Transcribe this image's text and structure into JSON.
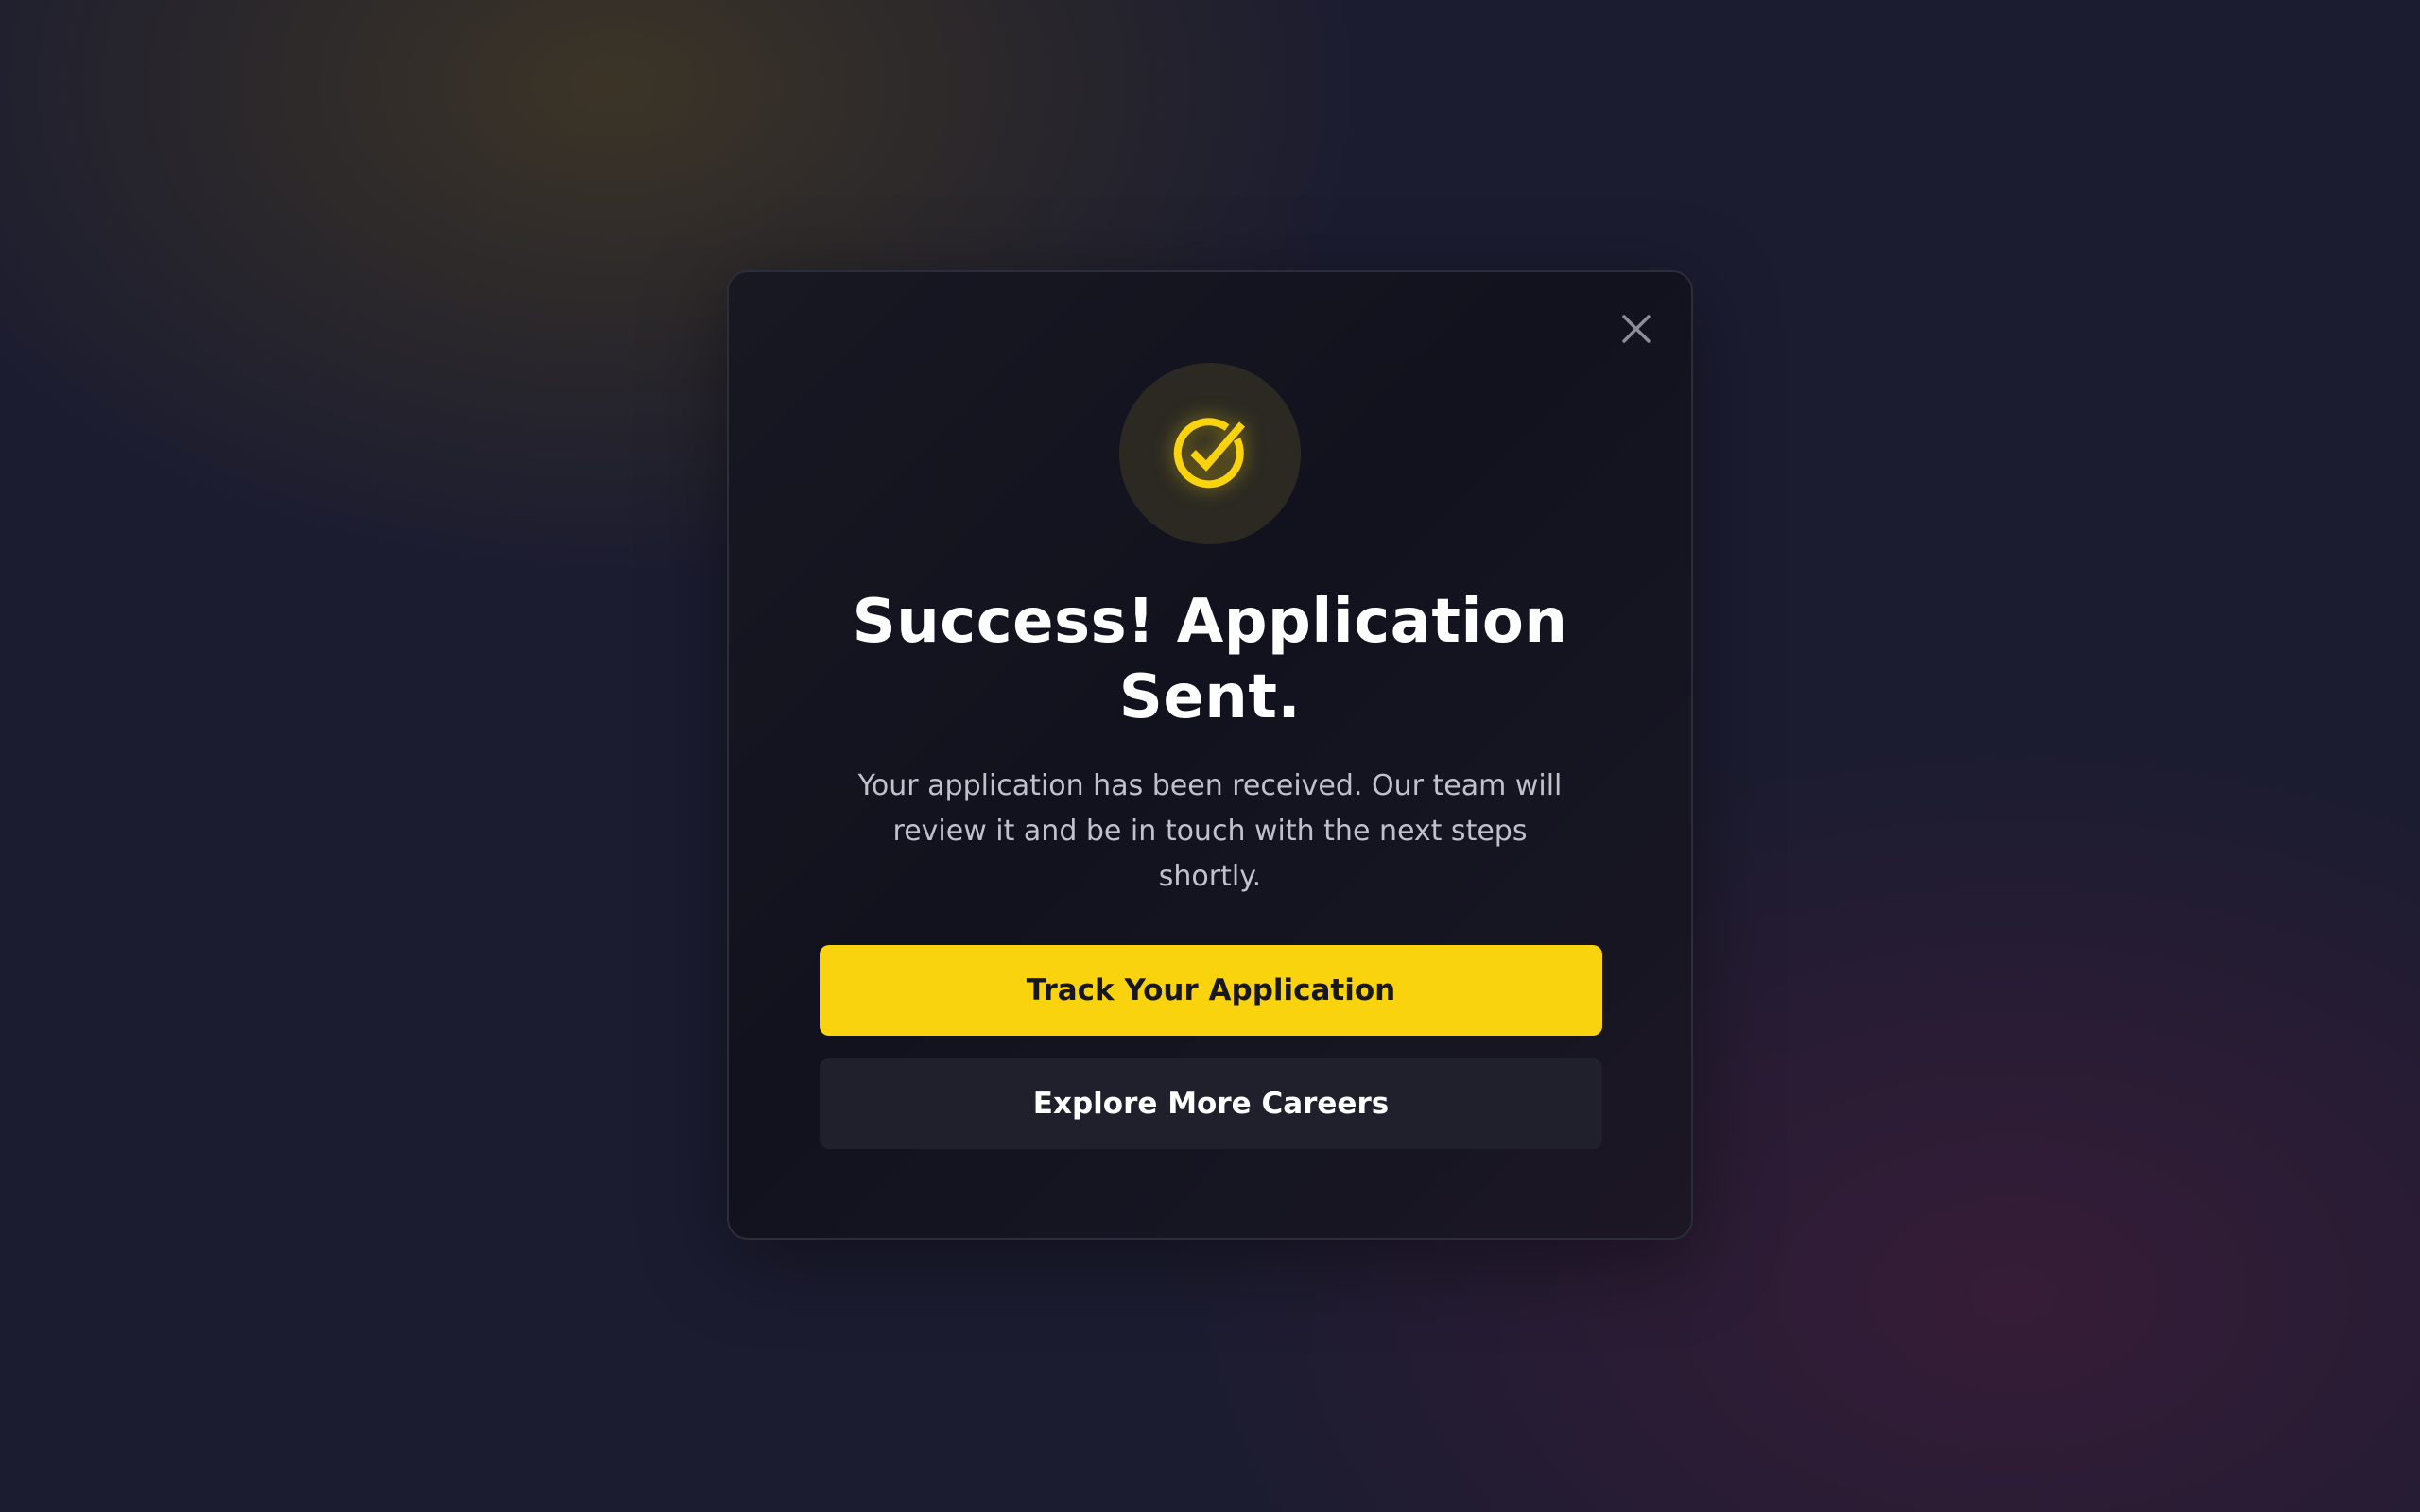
{
  "modal": {
    "close_icon": "close-icon",
    "status_icon": "check-circle-icon",
    "title_line1": "Success! Application",
    "title_line2": "Sent.",
    "message": "Your application has been received. Our team will review it and be in touch with the next steps shortly.",
    "primary_button_label": "Track Your Application",
    "secondary_button_label": "Explore More Careers"
  },
  "colors": {
    "accent": "#FAD30F",
    "modal_background": "#14141F",
    "page_background": "#1B1C30"
  }
}
